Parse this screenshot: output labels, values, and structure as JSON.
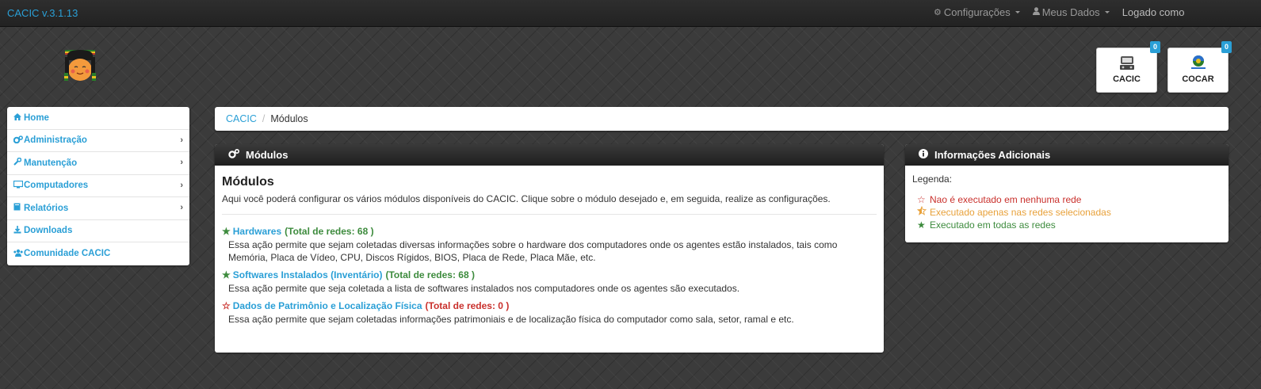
{
  "navbar": {
    "brand": "CACIC v.3.1.13",
    "configuracoes": "Configurações",
    "meus_dados": "Meus Dados",
    "logado": "Logado como"
  },
  "apps": {
    "cacic": {
      "label": "CACIC",
      "badge": "0"
    },
    "cocar": {
      "label": "COCAR",
      "badge": "0"
    }
  },
  "sidebar": {
    "items": [
      {
        "label": "Home",
        "icon": "home-icon"
      },
      {
        "label": "Administração",
        "icon": "cogs-icon"
      },
      {
        "label": "Manutenção",
        "icon": "wrench-icon"
      },
      {
        "label": "Computadores",
        "icon": "desktop-icon"
      },
      {
        "label": "Relatórios",
        "icon": "book-icon"
      },
      {
        "label": "Downloads",
        "icon": "download-icon"
      },
      {
        "label": "Comunidade CACIC",
        "icon": "users-icon"
      }
    ]
  },
  "breadcrumb": {
    "root": "CACIC",
    "sep": "/",
    "current": "Módulos"
  },
  "modulos": {
    "header": "Módulos",
    "title": "Módulos",
    "intro": "Aqui você poderá configurar os vários módulos disponíveis do CACIC. Clique sobre o módulo desejado e, em seguida, realize as configurações.",
    "items": [
      {
        "name": "Hardwares",
        "total": "(Total de redes: 68 )",
        "status": "all",
        "desc1": "Essa ação permite que sejam coletadas diversas informações sobre o hardware dos computadores onde os agentes estão instalados, tais como",
        "desc2": "Memória, Placa de Vídeo, CPU, Discos Rígidos, BIOS, Placa de Rede, Placa Mãe, etc."
      },
      {
        "name": "Softwares Instalados (Inventário)",
        "total": "(Total de redes: 68 )",
        "status": "all",
        "desc1": "Essa ação permite que seja coletada a lista de softwares instalados nos computadores onde os agentes são executados."
      },
      {
        "name": "Dados de Patrimônio e Localização Física",
        "total": "(Total de redes: 0 )",
        "status": "none",
        "desc1": "Essa ação permite que sejam coletadas informações patrimoniais e de localização física do computador como sala, setor, ramal e etc."
      }
    ]
  },
  "info": {
    "header": "Informações Adicionais",
    "legend_title": "Legenda:",
    "legend": [
      {
        "text": "Nao é executado em nenhuma rede",
        "color": "#c9302c"
      },
      {
        "text": "Executado apenas nas redes selecionadas",
        "color": "#e8a13a"
      },
      {
        "text": "Executado em todas as redes",
        "color": "#3d8b3d"
      }
    ]
  },
  "colors": {
    "accent": "#2a9fd6",
    "navbar": "#262626",
    "green": "#3d8b3d",
    "red": "#c9302c",
    "orange": "#e8a13a"
  }
}
